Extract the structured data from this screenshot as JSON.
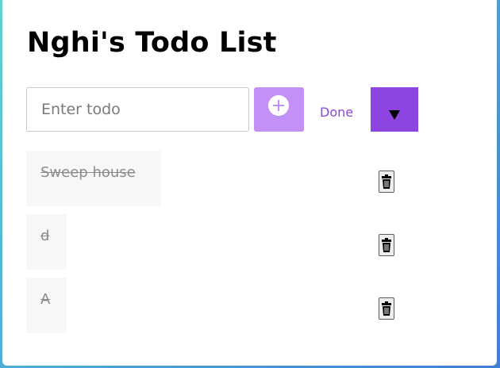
{
  "app": {
    "title": "Nghi's Todo List"
  },
  "form": {
    "input_placeholder": "Enter todo",
    "input_value": "",
    "add_icon": "plus-circle-icon",
    "filter_label": "Done",
    "filter_icon": "caret-down-icon"
  },
  "todos": [
    {
      "text": "Sweep house",
      "completed": true,
      "delete_icon": "trash-icon"
    },
    {
      "text": "d",
      "completed": true,
      "delete_icon": "trash-icon"
    },
    {
      "text": "A",
      "completed": true,
      "delete_icon": "trash-icon"
    }
  ],
  "colors": {
    "accent": "#8e44e0",
    "accent_light": "#c391f5",
    "item_background": "#f7f7f7",
    "completed_text": "#8b8b8b"
  }
}
